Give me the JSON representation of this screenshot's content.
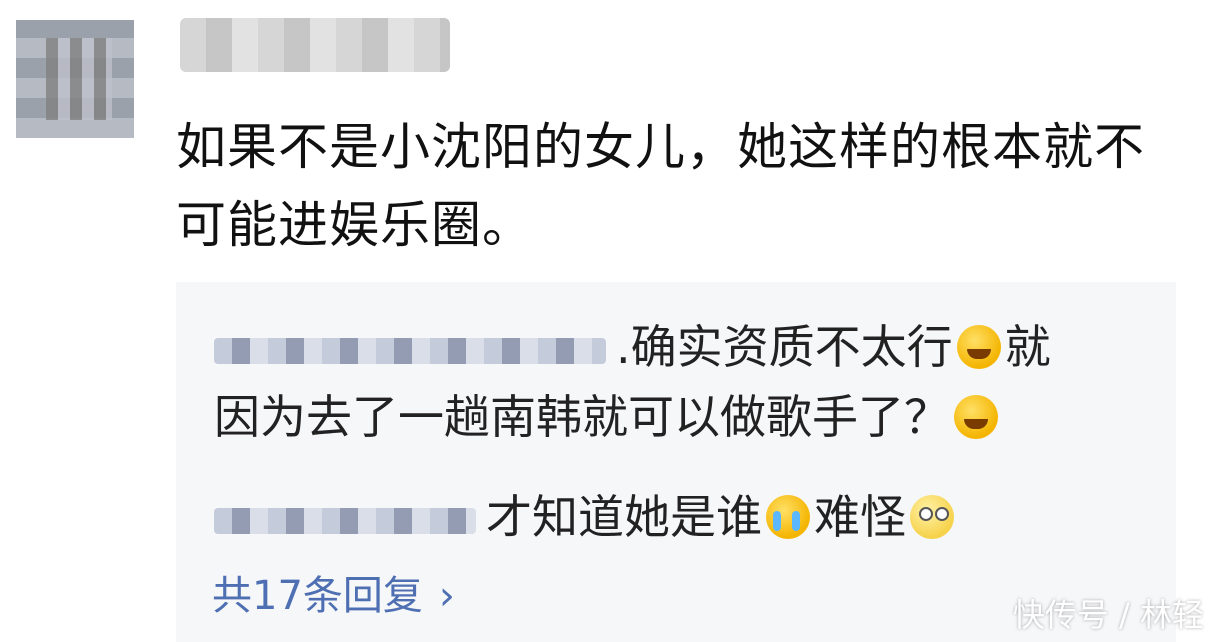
{
  "comment": {
    "text": "如果不是小沈阳的女儿，她这样的根本就不可能进娱乐圈。"
  },
  "replies": [
    {
      "prefix": ".",
      "text1": "确实资质不太行",
      "emoji1": "laughing-tears-emoji",
      "text2": "就",
      "line2": "因为去了一趟南韩就可以做歌手了？",
      "emoji2": "laughing-tears-emoji"
    },
    {
      "prefix": "",
      "text1": "才知道她是谁",
      "emoji1": "crying-emoji",
      "text2": "难怪",
      "emoji2": "eye-roll-emoji"
    }
  ],
  "reply_count_label": "共17条回复",
  "chevron": "›",
  "watermark": "快传号 / 林轻"
}
